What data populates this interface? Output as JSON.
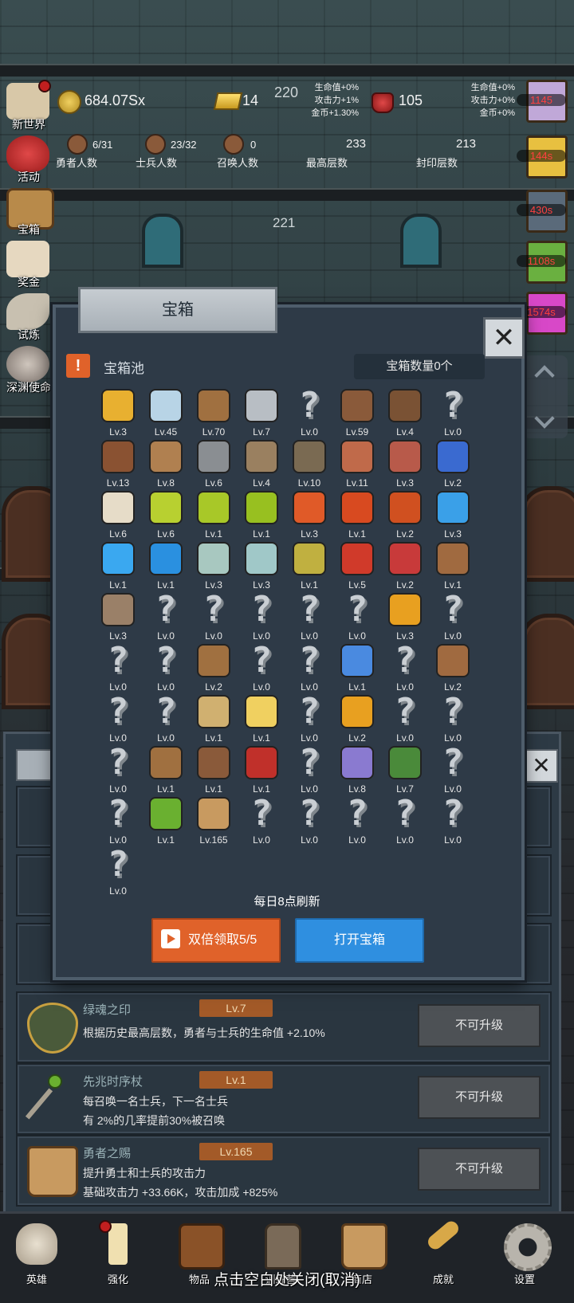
{
  "hud": {
    "coins": "684.07Sx",
    "gold": "14",
    "ruby": "105",
    "floor_center": "220",
    "buff_left": [
      "生命值+0%",
      "攻击力+1%",
      "金币+1.30%"
    ],
    "buff_right": [
      "生命值+0%",
      "攻击力+0%",
      "金币+0%"
    ],
    "heroes": {
      "value": "6/31",
      "label": "勇者人数"
    },
    "soldiers": {
      "value": "23/32",
      "label": "士兵人数"
    },
    "summons": {
      "value": "0",
      "label": "召唤人数"
    },
    "max_floor": {
      "value": "233",
      "label": "最高层数"
    },
    "sealed_floor": {
      "value": "213",
      "label": "封印层数"
    },
    "floor_below": "221"
  },
  "left_menu": [
    {
      "label": "新世界",
      "icon": "scroll-map-icon"
    },
    {
      "label": "活动",
      "icon": "heart-icon"
    },
    {
      "label": "宝箱",
      "icon": "treasure-chest-icon"
    },
    {
      "label": "奖金",
      "icon": "letter-icon"
    },
    {
      "label": "试炼",
      "icon": "wing-icon"
    },
    {
      "label": "深渊使命",
      "icon": "orb-icon"
    }
  ],
  "right_timers": [
    "1145",
    "144s",
    "430s",
    "1108s",
    "1574s"
  ],
  "dialog": {
    "tab_title": "宝箱",
    "pool_title": "宝箱池",
    "pool_count": "宝箱数量0个",
    "refresh_text": "每日8点刷新",
    "double_button": "双倍领取5/5",
    "open_button": "打开宝箱",
    "close_glyph": "✕"
  },
  "items": [
    {
      "lv": "Lv.3",
      "icon": "crown-icon",
      "color": "#e8b030"
    },
    {
      "lv": "Lv.45",
      "icon": "diamond-icon",
      "color": "#b8d4e6"
    },
    {
      "lv": "Lv.70",
      "icon": "wooden-sword-icon",
      "color": "#a07040"
    },
    {
      "lv": "Lv.7",
      "icon": "iron-sword-icon",
      "color": "#b8bec4"
    },
    {
      "lv": "Lv.0",
      "icon": "unknown"
    },
    {
      "lv": "Lv.59",
      "icon": "leather-armor-icon",
      "color": "#8a5a3a"
    },
    {
      "lv": "Lv.4",
      "icon": "backpack-icon",
      "color": "#7a5234"
    },
    {
      "lv": "Lv.0",
      "icon": "unknown"
    },
    {
      "lv": "Lv.13",
      "icon": "leather-helmet-icon",
      "color": "#8a5232"
    },
    {
      "lv": "Lv.8",
      "icon": "dagger-icon",
      "color": "#b08050"
    },
    {
      "lv": "Lv.6",
      "icon": "knight-helmet-icon",
      "color": "#8a8e92"
    },
    {
      "lv": "Lv.4",
      "icon": "hammer-icon",
      "color": "#9a8060"
    },
    {
      "lv": "Lv.10",
      "icon": "great-helm-icon",
      "color": "#7a6a52"
    },
    {
      "lv": "Lv.11",
      "icon": "meat-icon",
      "color": "#c06a4a"
    },
    {
      "lv": "Lv.3",
      "icon": "steak-icon",
      "color": "#b85a4a"
    },
    {
      "lv": "Lv.2",
      "icon": "blue-pouch-icon",
      "color": "#3a6ad0"
    },
    {
      "lv": "Lv.6",
      "icon": "rice-bowl-icon",
      "color": "#e6dcc8"
    },
    {
      "lv": "Lv.6",
      "icon": "green-potion-icon",
      "color": "#b8d030"
    },
    {
      "lv": "Lv.1",
      "icon": "green-potion-icon",
      "color": "#a8c828"
    },
    {
      "lv": "Lv.1",
      "icon": "green-potion-icon",
      "color": "#98c020"
    },
    {
      "lv": "Lv.3",
      "icon": "red-potion-icon",
      "color": "#e05a28"
    },
    {
      "lv": "Lv.1",
      "icon": "red-potion-icon",
      "color": "#d84a20"
    },
    {
      "lv": "Lv.2",
      "icon": "red-potion-icon",
      "color": "#d05020"
    },
    {
      "lv": "Lv.3",
      "icon": "blue-potion-icon",
      "color": "#3aa0e8"
    },
    {
      "lv": "Lv.1",
      "icon": "blue-potion-icon",
      "color": "#3aa8f0"
    },
    {
      "lv": "Lv.1",
      "icon": "blue-potion-icon",
      "color": "#2a90e0"
    },
    {
      "lv": "Lv.3",
      "icon": "empty-bottle-icon",
      "color": "#a8c8c0"
    },
    {
      "lv": "Lv.3",
      "icon": "empty-bottle-icon",
      "color": "#a0c8c8"
    },
    {
      "lv": "Lv.1",
      "icon": "long-bottle-icon",
      "color": "#c0b040"
    },
    {
      "lv": "Lv.5",
      "icon": "red-bottle-icon",
      "color": "#d03a2a"
    },
    {
      "lv": "Lv.2",
      "icon": "winged-boots-icon",
      "color": "#c83a3a"
    },
    {
      "lv": "Lv.1",
      "icon": "leather-boot-icon",
      "color": "#a06a40"
    },
    {
      "lv": "Lv.3",
      "icon": "boot-icon",
      "color": "#9a8068"
    },
    {
      "lv": "Lv.0",
      "icon": "unknown"
    },
    {
      "lv": "Lv.0",
      "icon": "unknown"
    },
    {
      "lv": "Lv.0",
      "icon": "unknown"
    },
    {
      "lv": "Lv.0",
      "icon": "unknown"
    },
    {
      "lv": "Lv.0",
      "icon": "unknown"
    },
    {
      "lv": "Lv.3",
      "icon": "torch-icon",
      "color": "#e8a020"
    },
    {
      "lv": "Lv.0",
      "icon": "unknown"
    },
    {
      "lv": "Lv.0",
      "icon": "unknown"
    },
    {
      "lv": "Lv.0",
      "icon": "unknown"
    },
    {
      "lv": "Lv.2",
      "icon": "wooden-staff-icon",
      "color": "#a07040"
    },
    {
      "lv": "Lv.0",
      "icon": "unknown"
    },
    {
      "lv": "Lv.0",
      "icon": "unknown"
    },
    {
      "lv": "Lv.1",
      "icon": "blue-wand-icon",
      "color": "#4a8ae0"
    },
    {
      "lv": "Lv.0",
      "icon": "unknown"
    },
    {
      "lv": "Lv.2",
      "icon": "leather-bag-icon",
      "color": "#a06a40"
    },
    {
      "lv": "Lv.0",
      "icon": "unknown"
    },
    {
      "lv": "Lv.0",
      "icon": "unknown"
    },
    {
      "lv": "Lv.1",
      "icon": "spiked-club-icon",
      "color": "#d0b070"
    },
    {
      "lv": "Lv.1",
      "icon": "cheese-icon",
      "color": "#f0d060"
    },
    {
      "lv": "Lv.0",
      "icon": "unknown"
    },
    {
      "lv": "Lv.2",
      "icon": "honey-jar-icon",
      "color": "#e8a020"
    },
    {
      "lv": "Lv.0",
      "icon": "unknown"
    },
    {
      "lv": "Lv.0",
      "icon": "unknown"
    },
    {
      "lv": "Lv.0",
      "icon": "unknown"
    },
    {
      "lv": "Lv.1",
      "icon": "bow-icon",
      "color": "#a07040"
    },
    {
      "lv": "Lv.1",
      "icon": "quiver-icon",
      "color": "#8a5a3a"
    },
    {
      "lv": "Lv.1",
      "icon": "fire-shield-icon",
      "color": "#c0302a"
    },
    {
      "lv": "Lv.0",
      "icon": "unknown"
    },
    {
      "lv": "Lv.8",
      "icon": "tentacle-charm-icon",
      "color": "#8a7ad0"
    },
    {
      "lv": "Lv.7",
      "icon": "green-soul-emblem-icon",
      "color": "#4a8a3a"
    },
    {
      "lv": "Lv.0",
      "icon": "unknown"
    },
    {
      "lv": "Lv.0",
      "icon": "unknown"
    },
    {
      "lv": "Lv.1",
      "icon": "green-orb-staff-icon",
      "color": "#6ab030"
    },
    {
      "lv": "Lv.165",
      "icon": "beer-mug-icon",
      "color": "#c89a60"
    },
    {
      "lv": "Lv.0",
      "icon": "unknown"
    },
    {
      "lv": "Lv.0",
      "icon": "unknown"
    },
    {
      "lv": "Lv.0",
      "icon": "unknown"
    },
    {
      "lv": "Lv.0",
      "icon": "unknown"
    },
    {
      "lv": "Lv.0",
      "icon": "unknown"
    },
    {
      "lv": "Lv.0",
      "icon": "unknown"
    }
  ],
  "unknown_glyph": "?",
  "upgrade_rows": [
    {
      "title": "绿魂之印",
      "lv": "Lv.7",
      "desc1": "根据历史最高层数，勇者与士兵的生命值 +2.10%",
      "desc2": "",
      "button": "不可升级",
      "icon": "green-soul-emblem-icon"
    },
    {
      "title": "先兆时序杖",
      "lv": "Lv.1",
      "desc1": "每召唤一名士兵，下一名士兵",
      "desc2": "有 2%的几率提前30%被召唤",
      "button": "不可升级",
      "icon": "green-orb-staff-icon"
    },
    {
      "title": "勇者之赐",
      "lv": "Lv.165",
      "desc1": "提升勇士和士兵的攻击力",
      "desc2": "基础攻击力 +33.66K，攻击加成 +825%",
      "button": "不可升级",
      "icon": "beer-mug-icon"
    }
  ],
  "bottom_nav": [
    {
      "label": "英雄",
      "icon": "skull-icon"
    },
    {
      "label": "强化",
      "icon": "candle-icon"
    },
    {
      "label": "物品",
      "icon": "book-icon"
    },
    {
      "label": "训练营",
      "icon": "lantern-icon"
    },
    {
      "label": "商店",
      "icon": "beer-mug-icon"
    },
    {
      "label": "成就",
      "icon": "key-icon"
    },
    {
      "label": "设置",
      "icon": "gear-icon"
    }
  ],
  "close_hint": "点击空白处关闭(取消)",
  "colors": {
    "accent_orange": "#e0622a",
    "accent_blue": "#2f8fe0",
    "timer_red": "#ff4040",
    "level_badge": "#a35a28"
  }
}
